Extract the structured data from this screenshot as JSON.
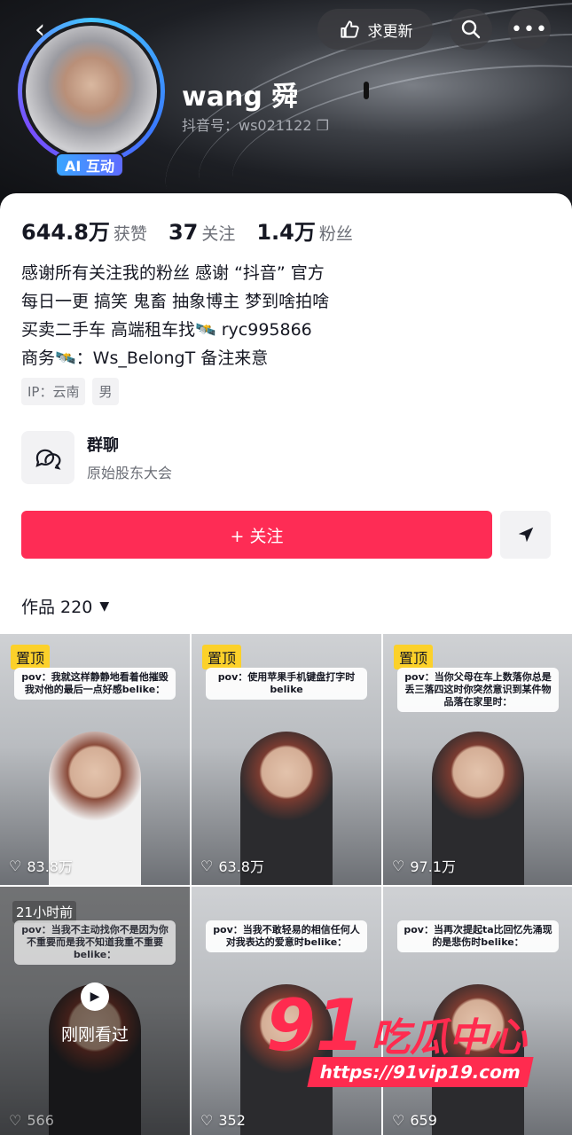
{
  "header": {
    "update_label": "求更新",
    "name": "wang 舜",
    "douyin_id": "抖音号：ws021122",
    "ai_badge": "AI 互动"
  },
  "stats": [
    {
      "num": "644.8万",
      "label": "获赞"
    },
    {
      "num": "37",
      "label": "关注"
    },
    {
      "num": "1.4万",
      "label": "粉丝"
    }
  ],
  "bio": [
    "感谢所有关注我的粉丝 感谢 “抖音” 官方",
    "每日一更 搞笑 鬼畜 抽象博主 梦到啥拍啥",
    "买卖二手车 高端租车找🛰️ ryc995866",
    "商务🛰️：Ws_BelongT 备注来意"
  ],
  "tags": [
    "IP：云南",
    "男"
  ],
  "group": {
    "title": "群聊",
    "subtitle": "原始股东大会"
  },
  "follow_label": "+ 关注",
  "works_label": "作品 220",
  "videos": [
    {
      "pinned": "置顶",
      "caption": "pov：我就这样静静地看着他摧毁我对他的最后一点好感belike：",
      "likes": "83.8万"
    },
    {
      "pinned": "置顶",
      "caption": "pov：使用苹果手机键盘打字时belike",
      "likes": "63.8万"
    },
    {
      "pinned": "置顶",
      "caption": "pov：当你父母在车上数落你总是丢三落四这时你突然意识到某件物品落在家里时：",
      "likes": "97.1万"
    },
    {
      "time": "21小时前",
      "caption": "pov：当我不主动找你不是因为你不重要而是我不知道我重不重要belike：",
      "watched": "刚刚看过",
      "likes": "566"
    },
    {
      "caption": "pov：当我不敢轻易的相信任何人对我表达的爱意时belike：",
      "likes": "352"
    },
    {
      "caption": "pov：当再次提起ta比回忆先涌现的是悲伤时belike：",
      "likes": "659"
    }
  ],
  "watermark": {
    "big": "91",
    "cn": "吃瓜中心",
    "url": "https://91vip19.com"
  }
}
